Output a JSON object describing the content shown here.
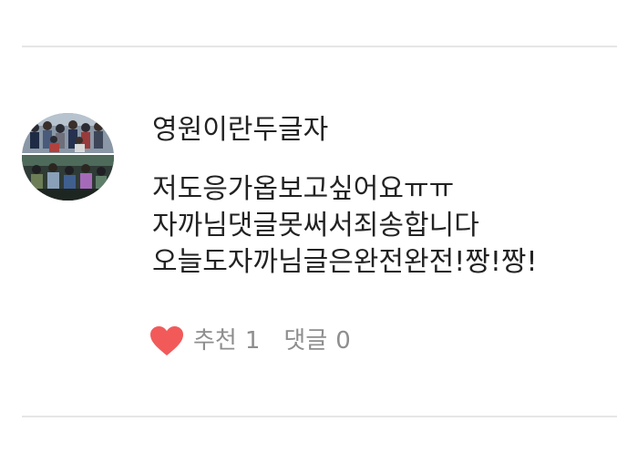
{
  "comment": {
    "author": "영원이란두글자",
    "lines": [
      "저도응가옵보고싶어요ㅠㅠ",
      "자까님댓글못써서죄송합니다",
      "오늘도자까님글은완전완전!짱!짱!"
    ],
    "like_label": "추천",
    "like_count": "1",
    "reply_label": "댓글",
    "reply_count": "0"
  },
  "colors": {
    "heart": "#f25a5a",
    "meta_text": "#8e8e8e",
    "body_text": "#222222",
    "divider": "#e6e6e6"
  },
  "icons": {
    "like": "heart-icon"
  }
}
